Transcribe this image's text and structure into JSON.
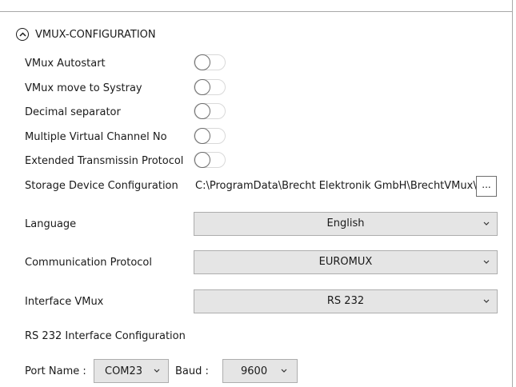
{
  "section": {
    "title": "VMUX-CONFIGURATION"
  },
  "toggles": [
    {
      "label": "VMux Autostart",
      "on": false
    },
    {
      "label": "VMux move to Systray",
      "on": false
    },
    {
      "label": "Decimal separator",
      "on": false
    },
    {
      "label": "Multiple Virtual Channel No",
      "on": false
    },
    {
      "label": "Extended Transmissin Protocol",
      "on": false
    }
  ],
  "storage": {
    "label": "Storage Device Configuration",
    "path": "C:\\ProgramData\\Brecht Elektronik GmbH\\BrechtVMux\\",
    "browse_label": "..."
  },
  "language": {
    "label": "Language",
    "value": "English"
  },
  "protocol": {
    "label": "Communication Protocol",
    "value": "EUROMUX"
  },
  "interface": {
    "label": "Interface VMux",
    "value": "RS 232"
  },
  "rs232": {
    "heading": "RS 232 Interface Configuration",
    "port_label": "Port Name :",
    "port_value": "COM23",
    "baud_label": "Baud :",
    "baud_value": "9600"
  },
  "icons": {
    "collapse": "chevron-up-in-circle",
    "dropdown": "chevron-down"
  }
}
